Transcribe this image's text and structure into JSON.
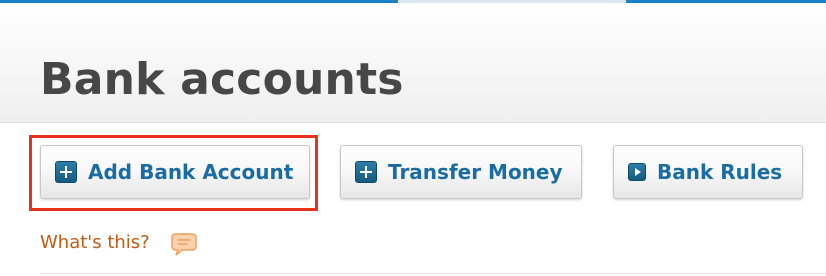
{
  "header": {
    "title": "Bank accounts"
  },
  "toolbar": {
    "add_label": "Add Bank Account",
    "transfer_label": "Transfer Money",
    "rules_label": "Bank Rules"
  },
  "help": {
    "link_label": "What's this?"
  },
  "colors": {
    "accent": "#1a6ca4",
    "icon_fill": "#1c6690",
    "highlight": "#e8321c",
    "help_text": "#c25a12",
    "help_icon": "#f0a05c"
  },
  "icons": [
    "plus-icon",
    "plus-icon",
    "play-icon",
    "speech-bubble-icon"
  ]
}
